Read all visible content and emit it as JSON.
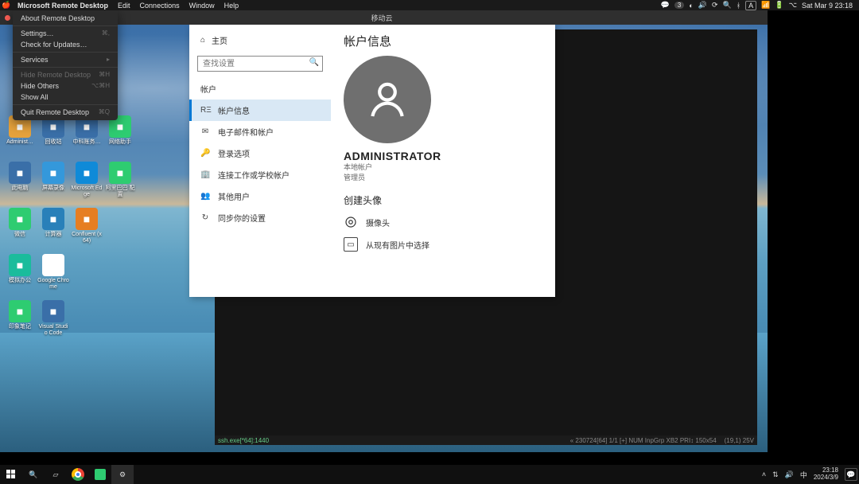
{
  "mac_menubar": {
    "app_name": "Microsoft Remote Desktop",
    "menus": [
      "Edit",
      "Connections",
      "Window",
      "Help"
    ],
    "wechat_badge": "3",
    "input_method": "A",
    "battery": "",
    "datetime": "Sat Mar 9  23:18"
  },
  "mac_dropdown": {
    "items": [
      {
        "label": "About Remote Desktop",
        "dim": false
      },
      {
        "sep": true
      },
      {
        "label": "Settings…",
        "shortcut": "⌘,",
        "dim": false
      },
      {
        "label": "Check for Updates…",
        "dim": false
      },
      {
        "sep": true
      },
      {
        "label": "Services",
        "shortcut": "▸",
        "dim": false
      },
      {
        "sep": true
      },
      {
        "label": "Hide Remote Desktop",
        "shortcut": "⌘H",
        "dim": true
      },
      {
        "label": "Hide Others",
        "shortcut": "⌥⌘H",
        "dim": false
      },
      {
        "label": "Show All",
        "dim": false
      },
      {
        "sep": true
      },
      {
        "label": "Quit Remote Desktop",
        "shortcut": "⌘Q",
        "dim": false
      }
    ]
  },
  "remote_window": {
    "title": "移动云"
  },
  "desktop_icons": [
    {
      "label": "Administ…",
      "color": "#e6a23c"
    },
    {
      "label": "回收站",
      "color": "#3a6fa8"
    },
    {
      "label": "中科账务…",
      "color": "#3a6fa8"
    },
    {
      "label": "网络助手",
      "color": "#2ecc71"
    },
    {
      "label": "此电脑",
      "color": "#3a6fa8"
    },
    {
      "label": "屏幕录像",
      "color": "#3498db"
    },
    {
      "label": "Microsoft Edge",
      "color": "#0f8ad8"
    },
    {
      "label": "阿里巴巴 配置",
      "color": "#2ecc71"
    },
    {
      "label": "微信",
      "color": "#2ecc71"
    },
    {
      "label": "计算器",
      "color": "#2980b9"
    },
    {
      "label": "Confluent (x64)",
      "color": "#e67e22"
    },
    {
      "label": "",
      "color": "transparent"
    },
    {
      "label": "模拟办公",
      "color": "#1abc9c"
    },
    {
      "label": "Google Chrome",
      "color": "#fff"
    },
    {
      "label": "",
      "color": "transparent"
    },
    {
      "label": "",
      "color": "transparent"
    },
    {
      "label": "印象笔记",
      "color": "#2ecc71"
    },
    {
      "label": "Visual Studio Code",
      "color": "#3a6fa8"
    }
  ],
  "terminal": {
    "left": "ssh.exe[*64]:1440",
    "right_a": "« 230724[64]   1/1   [+] NUM  InpGrp  XB2  PRI↕   150x54",
    "right_b": "(19,1) 25V"
  },
  "settings": {
    "home": "主页",
    "search_placeholder": "查找设置",
    "section": "帐户",
    "nav": [
      {
        "icon": "RΞ",
        "label": "帐户信息",
        "active": true
      },
      {
        "icon": "✉",
        "label": "电子邮件和帐户"
      },
      {
        "icon": "🔑",
        "label": "登录选项"
      },
      {
        "icon": "🏢",
        "label": "连接工作或学校帐户"
      },
      {
        "icon": "👥",
        "label": "其他用户"
      },
      {
        "icon": "↻",
        "label": "同步你的设置"
      }
    ],
    "page_title": "帐户信息",
    "account_name": "ADMINISTRATOR",
    "account_type": "本地帐户",
    "account_role": "管理员",
    "create_avatar": "创建头像",
    "opt_camera": "摄像头",
    "opt_browse": "从现有图片中选择"
  },
  "host_taskbar": {
    "time": "23:18",
    "date": "2024/3/9"
  }
}
